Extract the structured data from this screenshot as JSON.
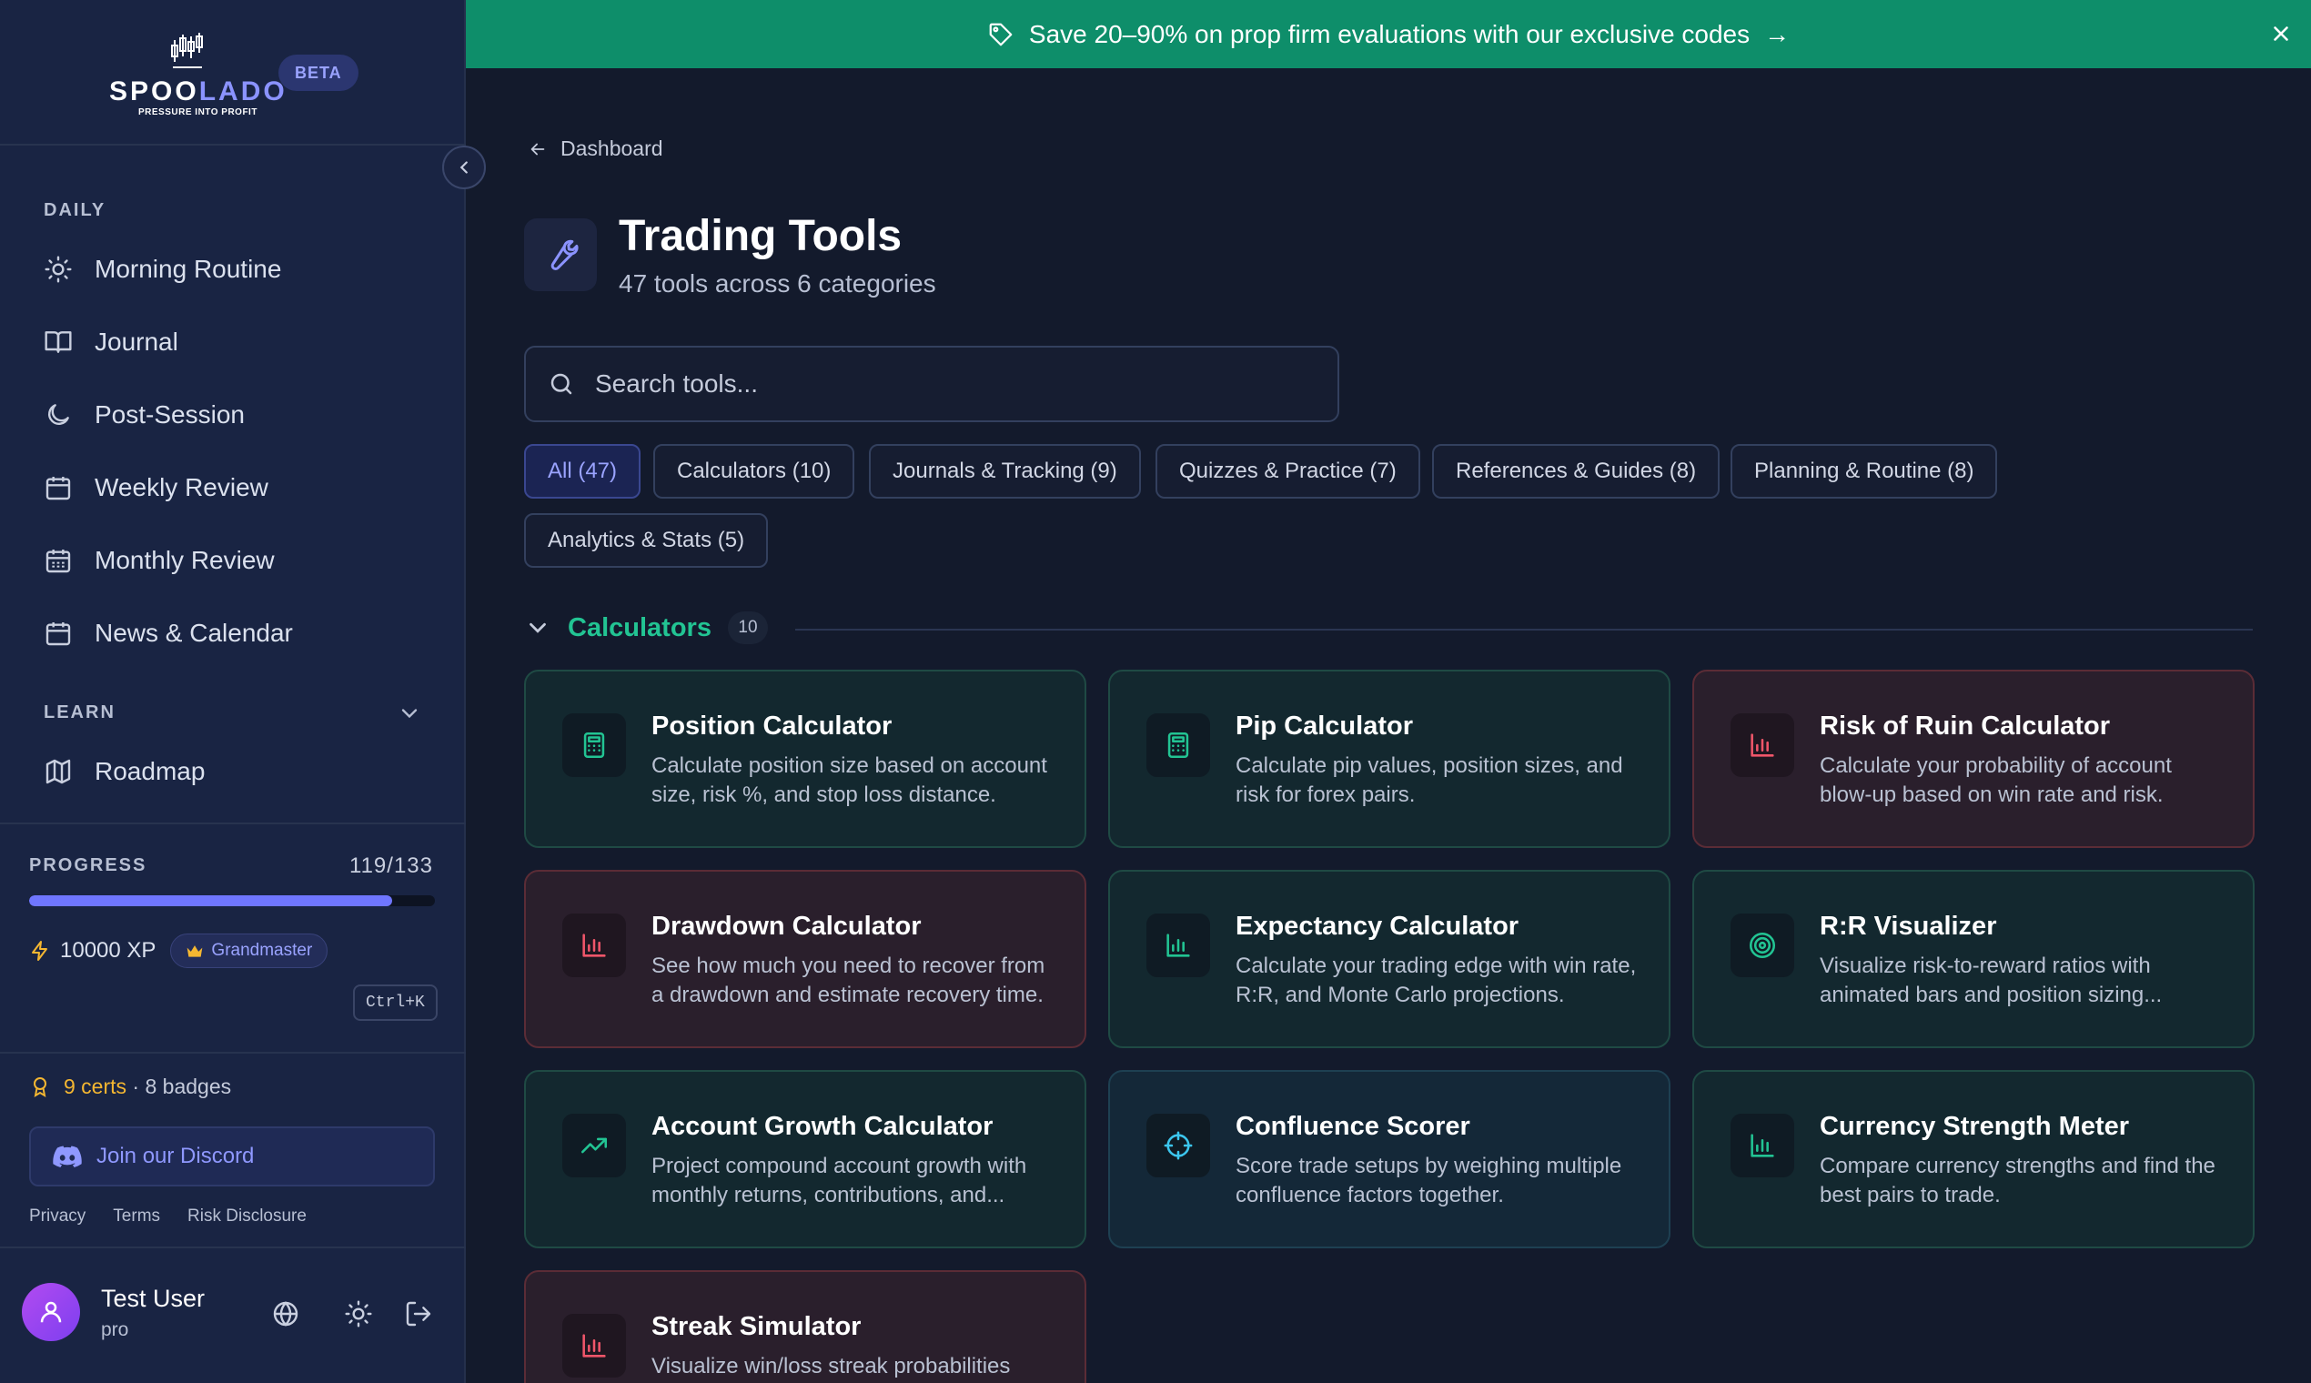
{
  "brand": {
    "name_a": "SPOO",
    "name_b": "LADO",
    "tagline": "PRESSURE INTO PROFIT",
    "badge": "BETA"
  },
  "banner": {
    "text": "Save 20–90% on prop firm evaluations with our exclusive codes",
    "arrow": "→"
  },
  "sidebar": {
    "daily_label": "DAILY",
    "daily": [
      {
        "label": "Morning Routine",
        "icon": "sun-icon"
      },
      {
        "label": "Journal",
        "icon": "book-icon"
      },
      {
        "label": "Post-Session",
        "icon": "moon-icon"
      },
      {
        "label": "Weekly Review",
        "icon": "calendar-icon"
      },
      {
        "label": "Monthly Review",
        "icon": "calendar-grid-icon"
      },
      {
        "label": "News & Calendar",
        "icon": "calendar-icon"
      }
    ],
    "learn_label": "LEARN",
    "learn": [
      {
        "label": "Roadmap",
        "icon": "map-icon"
      }
    ],
    "progress": {
      "label": "PROGRESS",
      "count": "119/133",
      "fraction": 0.895
    },
    "xp": "10000 XP",
    "rank": "Grandmaster",
    "shortcut": "Ctrl+K",
    "certs": "9 certs",
    "badges": "· 8 badges",
    "discord": "Join our Discord",
    "links": [
      "Privacy",
      "Terms",
      "Risk Disclosure"
    ],
    "user": {
      "name": "Test User",
      "role": "pro"
    }
  },
  "main": {
    "breadcrumb": "Dashboard",
    "title": "Trading Tools",
    "subtitle": "47 tools across 6 categories",
    "search_placeholder": "Search tools...",
    "filters": [
      "All (47)",
      "Calculators (10)",
      "Journals & Tracking (9)",
      "Quizzes & Practice (7)",
      "References & Guides (8)",
      "Planning & Routine (8)",
      "Analytics & Stats (5)"
    ],
    "section": {
      "title": "Calculators",
      "count": "10"
    },
    "cards": [
      {
        "title": "Position Calculator",
        "desc": "Calculate position size based on account size, risk %, and stop loss distance.",
        "theme": "green",
        "icon": "calculator-icon",
        "color": "#22c493"
      },
      {
        "title": "Pip Calculator",
        "desc": "Calculate pip values, position sizes, and risk for forex pairs.",
        "theme": "green",
        "icon": "calculator-icon",
        "color": "#22c493"
      },
      {
        "title": "Risk of Ruin Calculator",
        "desc": "Calculate your probability of account blow-up based on win rate and risk.",
        "theme": "red",
        "icon": "bar-chart-icon",
        "color": "#f0566a"
      },
      {
        "title": "Drawdown Calculator",
        "desc": "See how much you need to recover from a drawdown and estimate recovery time.",
        "theme": "red",
        "icon": "bar-chart-icon",
        "color": "#f0566a"
      },
      {
        "title": "Expectancy Calculator",
        "desc": "Calculate your trading edge with win rate, R:R, and Monte Carlo projections.",
        "theme": "green",
        "icon": "bar-chart-icon",
        "color": "#22c493"
      },
      {
        "title": "R:R Visualizer",
        "desc": "Visualize risk-to-reward ratios with animated bars and position sizing...",
        "theme": "green",
        "icon": "target-icon",
        "color": "#22c493"
      },
      {
        "title": "Account Growth Calculator",
        "desc": "Project compound account growth with monthly returns, contributions, and...",
        "theme": "green",
        "icon": "trending-up-icon",
        "color": "#22c493"
      },
      {
        "title": "Confluence Scorer",
        "desc": "Score trade setups by weighing multiple confluence factors together.",
        "theme": "blue",
        "icon": "crosshair-icon",
        "color": "#3cc6ee"
      },
      {
        "title": "Currency Strength Meter",
        "desc": "Compare currency strengths and find the best pairs to trade.",
        "theme": "green",
        "icon": "bar-chart-icon",
        "color": "#22c493"
      },
      {
        "title": "Streak Simulator",
        "desc": "Visualize win/loss streak probabilities",
        "theme": "red",
        "icon": "bar-chart-icon",
        "color": "#f0566a"
      }
    ]
  }
}
